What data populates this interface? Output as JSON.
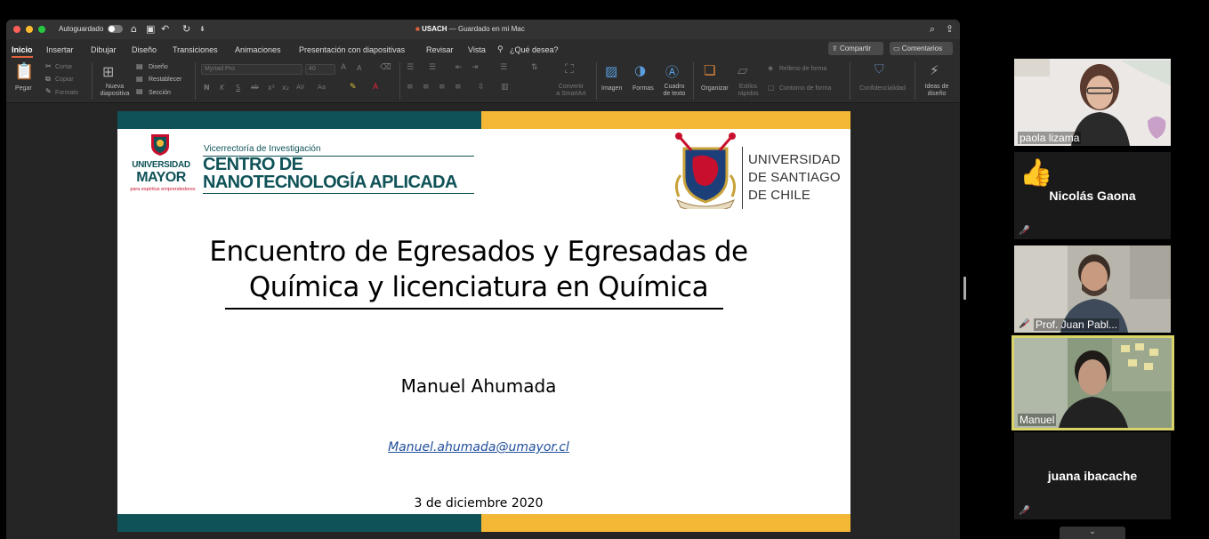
{
  "window": {
    "autosave_label": "Autoguardado",
    "doc_title": "USACH",
    "doc_status": "— Guardado en mi Mac",
    "colors": {
      "close": "#ff5f57",
      "minimize": "#febc2e",
      "maximize": "#28c840"
    }
  },
  "tabs": [
    {
      "label": "Inicio"
    },
    {
      "label": "Insertar"
    },
    {
      "label": "Dibujar"
    },
    {
      "label": "Diseño"
    },
    {
      "label": "Transiciones"
    },
    {
      "label": "Animaciones"
    },
    {
      "label": "Presentación con diapositivas"
    },
    {
      "label": "Revisar"
    },
    {
      "label": "Vista"
    },
    {
      "label": "¿Qué desea?"
    }
  ],
  "share_label": "Compartir",
  "comments_label": "Comentarios",
  "ribbon": {
    "paste": "Pegar",
    "cut": "Cortar",
    "copy": "Copiar",
    "format": "Formato",
    "new_slide_1": "Nueva",
    "new_slide_2": "diapositiva",
    "layout": "Diseño",
    "reset": "Restablecer",
    "section": "Sección",
    "font_name": "Myriad Pro",
    "font_size": "40",
    "convert_1": "Convertir",
    "convert_2": "a SmartArt",
    "image": "Imagen",
    "shapes": "Formas",
    "textbox_1": "Cuadro",
    "textbox_2": "de texto",
    "arrange": "Organizar",
    "quick_styles_1": "Estilos",
    "quick_styles_2": "rápidos",
    "shape_fill": "Relleno de forma",
    "shape_outline": "Contorno de forma",
    "confidentiality": "Confidencialidad",
    "design_ideas_1": "Ideas de",
    "design_ideas_2": "diseño"
  },
  "slide": {
    "um_name1": "UNIVERSIDAD",
    "um_name2": "MAYOR",
    "um_tagline": "para espíritus emprendedores",
    "cn_subtitle": "Vicerrectoría de Investigación",
    "cn_title1": "CENTRO DE",
    "cn_title2": "NANOTECNOLOGÍA APLICADA",
    "usach_line1": "UNIVERSIDAD",
    "usach_line2": "DE SANTIAGO",
    "usach_line3": "DE CHILE",
    "title_line1": "Encuentro de Egresados y Egresadas de",
    "title_line2": "Química y licenciatura en Química",
    "presenter": "Manuel Ahumada",
    "email": "Manuel.ahumada@umayor.cl",
    "date": "3 de diciembre 2020",
    "colors": {
      "teal": "#0f5257",
      "yellow": "#f4b736"
    }
  },
  "participants": [
    {
      "name": "paola lizama"
    },
    {
      "name": "Nicolás Gaona"
    },
    {
      "name": "Prof. Juan Pabl..."
    },
    {
      "name": "Manuel"
    },
    {
      "name": "juana ibacache"
    }
  ]
}
